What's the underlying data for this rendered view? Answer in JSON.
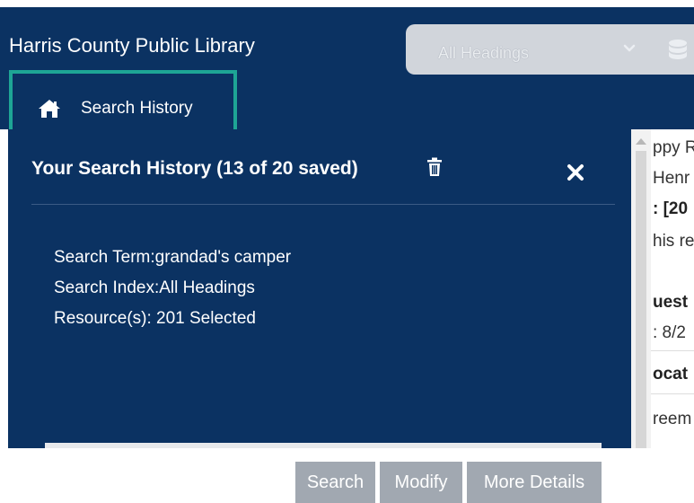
{
  "header": {
    "library_name": "Harris County Public Library",
    "heading_select": {
      "value": "All Headings"
    }
  },
  "breadcrumb": {
    "label": "Search History"
  },
  "panel": {
    "title": "Your Search History (13 of 20 saved)",
    "entry": {
      "search_term": "Search Term:grandad's camper",
      "search_index": "Search Index:All Headings",
      "resources": "Resource(s): 201 Selected",
      "buttons": {
        "search": "Search",
        "modify": "Modify",
        "more_details": "More Details"
      }
    }
  },
  "background_content": {
    "fragments": [
      "ppy R",
      "Henr",
      ": [20",
      "his re",
      "uest",
      ": 8/2",
      "ocat",
      "reem"
    ]
  },
  "colors": {
    "navy": "#0b3262",
    "highlight_border": "#1ea595",
    "button_gray": "#a1a8b1"
  },
  "icons": {
    "home": "home-icon",
    "trash": "trash-icon",
    "close": "close-icon",
    "chevron": "chevron-down-icon",
    "database": "database-icon"
  }
}
